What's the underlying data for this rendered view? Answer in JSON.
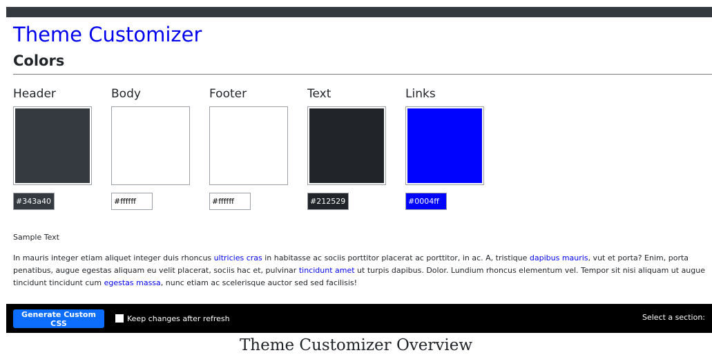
{
  "header": {
    "title": "Theme Customizer",
    "section": "Colors"
  },
  "swatches": [
    {
      "label": "Header",
      "color": "#343a40",
      "hex": "#343a40",
      "hex_text_color": "#ffffff"
    },
    {
      "label": "Body",
      "color": "#ffffff",
      "hex": "#ffffff",
      "hex_text_color": "#000000"
    },
    {
      "label": "Footer",
      "color": "#ffffff",
      "hex": "#ffffff",
      "hex_text_color": "#000000"
    },
    {
      "label": "Text",
      "color": "#212529",
      "hex": "#212529",
      "hex_text_color": "#ffffff"
    },
    {
      "label": "Links",
      "color": "#0004ff",
      "hex": "#0004ff",
      "hex_text_color": "#ffffff"
    }
  ],
  "sample": {
    "heading": "Sample Text",
    "segments": [
      {
        "text": "In mauris integer etiam aliquet integer duis rhoncus ",
        "link": false
      },
      {
        "text": "ultricies cras",
        "link": true
      },
      {
        "text": " in habitasse ac sociis porttitor placerat ac porttitor, in ac. A, tristique ",
        "link": false
      },
      {
        "text": "dapibus mauris",
        "link": true
      },
      {
        "text": ", vut et porta? Enim, porta penatibus, augue egestas aliquam eu velit placerat, sociis hac et, pulvinar ",
        "link": false
      },
      {
        "text": "tincidunt amet",
        "link": true
      },
      {
        "text": " ut turpis dapibus. Dolor. Lundium rhoncus elementum vel. Tempor sit nisi aliquam ut augue tincidunt tincidunt cum ",
        "link": false
      },
      {
        "text": "egestas massa",
        "link": true
      },
      {
        "text": ", nunc etiam ac scelerisque auctor sed sed facilisis!",
        "link": false
      }
    ]
  },
  "footer": {
    "generate_label": "Generate Custom CSS",
    "keep_label": "Keep changes after refresh",
    "select_section_label": "Select a section:"
  },
  "caption": "Theme Customizer Overview"
}
